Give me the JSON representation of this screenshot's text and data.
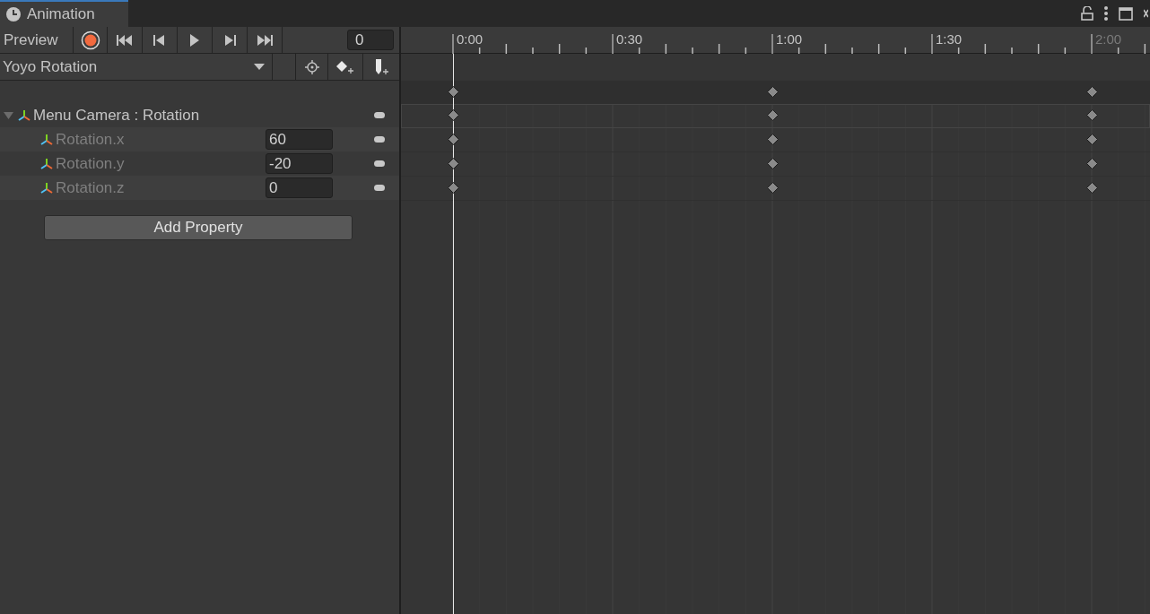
{
  "tab": {
    "title": "Animation",
    "selected": true
  },
  "toolbar": {
    "preview_label": "Preview",
    "frame": "0",
    "clip": "Yoyo Rotation"
  },
  "properties": [
    {
      "label": "Menu Camera : Rotation",
      "expanded": true,
      "children": [
        {
          "label": "Rotation.x",
          "value": "60"
        },
        {
          "label": "Rotation.y",
          "value": "-20"
        },
        {
          "label": "Rotation.z",
          "value": "0"
        }
      ]
    }
  ],
  "add_property": "Add Property",
  "ruler": [
    {
      "label": "0:00",
      "keyframe": true,
      "dimmed": false
    },
    {
      "label": "0:30",
      "keyframe": false,
      "dimmed": false
    },
    {
      "label": "1:00",
      "keyframe": true,
      "dimmed": false
    },
    {
      "label": "1:30",
      "keyframe": false,
      "dimmed": false
    },
    {
      "label": "2:00",
      "keyframe": true,
      "dimmed": true
    }
  ]
}
